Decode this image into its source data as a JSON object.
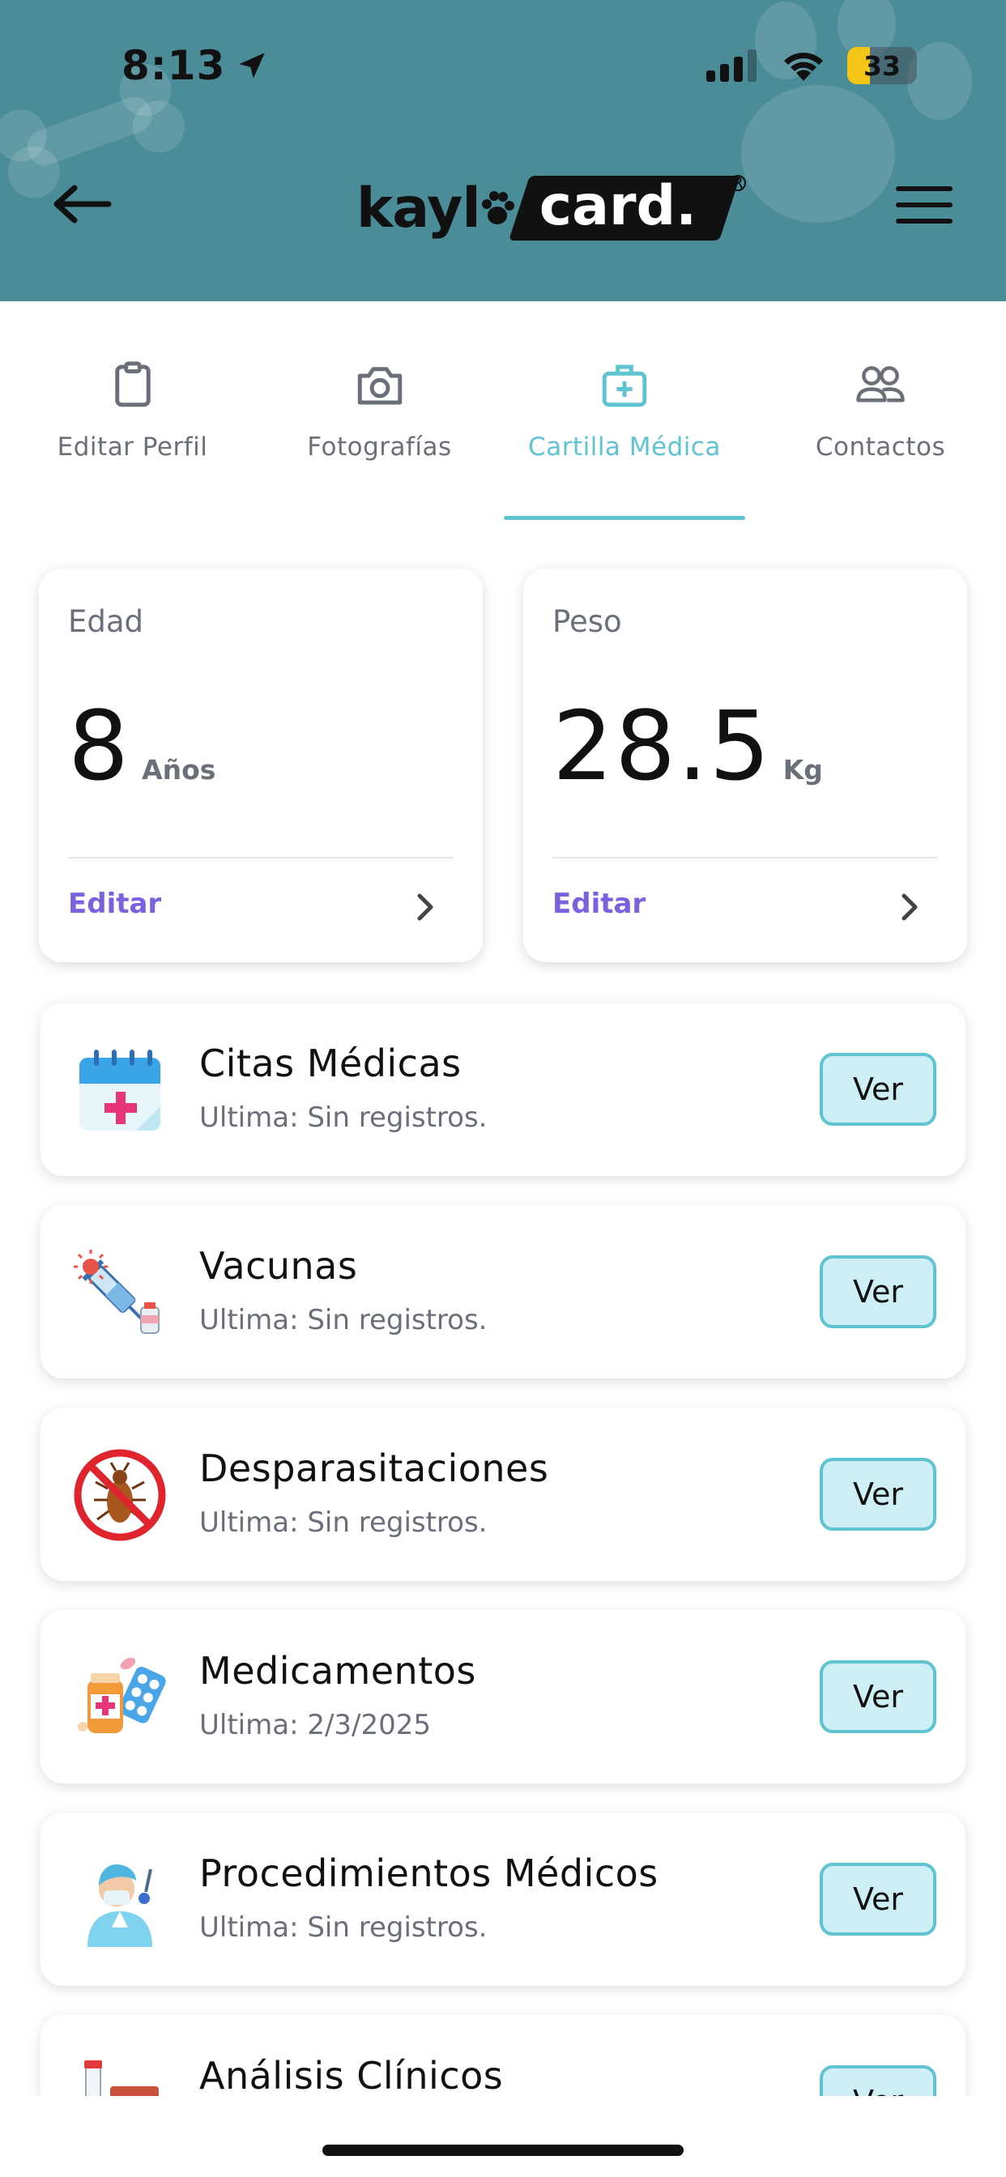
{
  "status_bar": {
    "time": "8:13",
    "battery": "33",
    "battery_level": 0.33
  },
  "header": {
    "logo_left": "kayl",
    "logo_right": "card."
  },
  "tabs": [
    {
      "label": "Editar Perfil",
      "icon": "clipboard-icon",
      "active": false
    },
    {
      "label": "Fotografías",
      "icon": "camera-icon",
      "active": false
    },
    {
      "label": "Cartilla Médica",
      "icon": "medical-kit-icon",
      "active": true
    },
    {
      "label": "Contactos",
      "icon": "users-icon",
      "active": false
    }
  ],
  "stats": {
    "age": {
      "label": "Edad",
      "value": "8",
      "unit": "Años",
      "action": "Editar"
    },
    "weight": {
      "label": "Peso",
      "value": "28.5",
      "unit": "Kg",
      "action": "Editar"
    }
  },
  "records": [
    {
      "title": "Citas Médicas",
      "subtitle": "Ultima: Sin registros.",
      "button": "Ver",
      "icon": "calendar-medical-icon"
    },
    {
      "title": "Vacunas",
      "subtitle": "Ultima: Sin registros.",
      "button": "Ver",
      "icon": "syringe-icon"
    },
    {
      "title": "Desparasitaciones",
      "subtitle": "Ultima: Sin registros.",
      "button": "Ver",
      "icon": "no-parasite-icon"
    },
    {
      "title": "Medicamentos",
      "subtitle": "Ultima: 2/3/2025",
      "button": "Ver",
      "icon": "medicine-icon"
    },
    {
      "title": "Procedimientos Médicos",
      "subtitle": "Ultima: Sin registros.",
      "button": "Ver",
      "icon": "surgeon-icon"
    },
    {
      "title": "Análisis Clínicos",
      "subtitle": "",
      "button": "Ver",
      "icon": "lab-test-icon"
    }
  ],
  "colors": {
    "header_bg": "#4a8c98",
    "accent": "#5fc4cf",
    "edit_link": "#7b61e0",
    "button_bg": "#cdeff5"
  }
}
